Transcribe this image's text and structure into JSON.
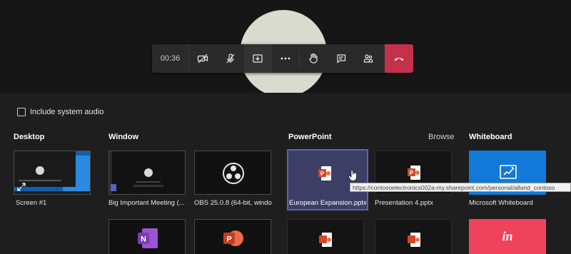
{
  "toolbar": {
    "timer": "00:36",
    "buttons": [
      "camera-off",
      "mic-off",
      "share-tray",
      "more",
      "raise-hand",
      "chat",
      "participants",
      "hang-up"
    ]
  },
  "share": {
    "include_audio_label": "Include system audio",
    "include_audio_checked": false,
    "sections": {
      "desktop": "Desktop",
      "window": "Window",
      "powerpoint": "PowerPoint",
      "browse": "Browse",
      "whiteboard": "Whiteboard"
    },
    "desktop_tiles": [
      {
        "label": "Screen #1"
      }
    ],
    "window_tiles": [
      {
        "label": "Big Important Meeting (..."
      },
      {
        "label": "OBS 25.0.8 (64-bit, windo..."
      }
    ],
    "powerpoint_tiles": [
      {
        "label": "European Expansion.pptx",
        "selected": true
      },
      {
        "label": "Presentation 4.pptx"
      }
    ],
    "whiteboard_tiles": [
      {
        "label": "Microsoft Whiteboard"
      }
    ],
    "tooltip": "https://contosoelectronics002a-my.sharepoint.com/personal/alland_contoso"
  },
  "colors": {
    "accent": "#6264a7",
    "hangup": "#c4314b",
    "whiteboard": "#1279d8",
    "invision": "#f0435b",
    "powerpoint": "#d0472a",
    "onenote": "#7a3bb3"
  }
}
